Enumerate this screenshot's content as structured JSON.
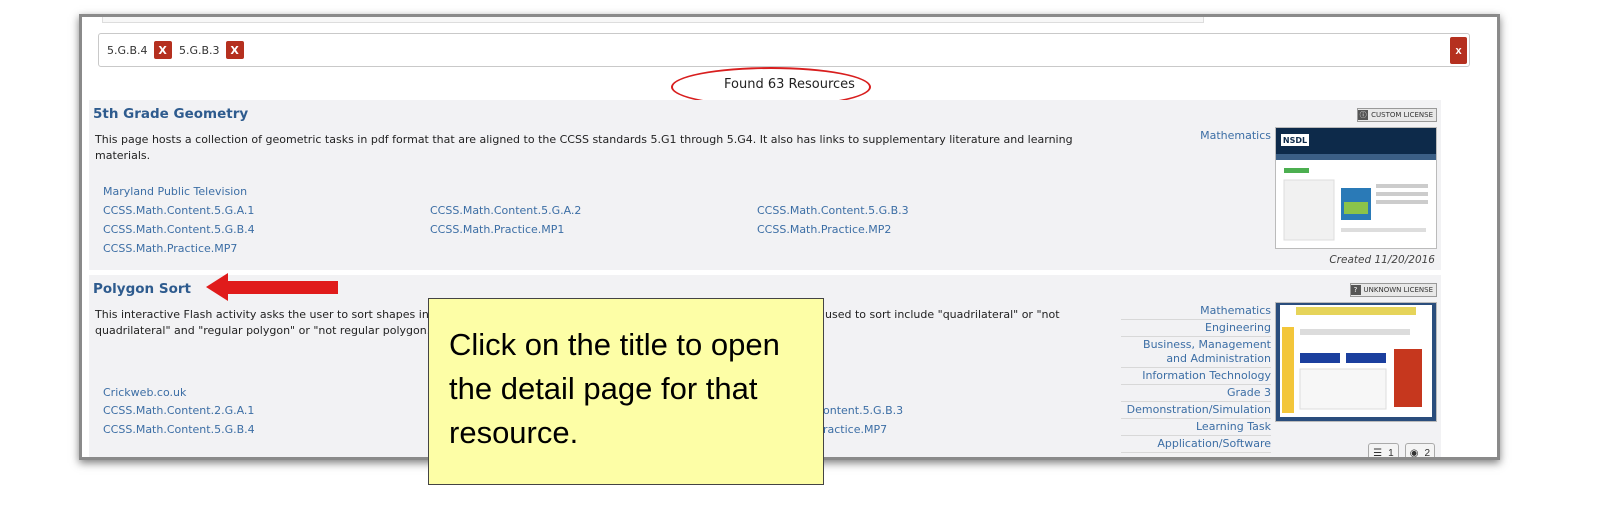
{
  "filters": {
    "chips": [
      {
        "label": "5.G.B.4",
        "remove": "X"
      },
      {
        "label": "5.G.B.3",
        "remove": "X"
      }
    ],
    "clear_all": "x"
  },
  "found_text": "Found 63 Resources",
  "results": [
    {
      "title": "5th Grade Geometry",
      "description": "This page hosts a collection of geometric tasks in pdf format that are aligned to the CCSS standards 5.G1 through 5.G4. It also has links to supplementary literature and learning materials.",
      "publisher": "Maryland Public Television",
      "standards": [
        "CCSS.Math.Content.5.G.A.1",
        "CCSS.Math.Content.5.G.A.2",
        "CCSS.Math.Content.5.G.B.3",
        "CCSS.Math.Content.5.G.B.4",
        "CCSS.Math.Practice.MP1",
        "CCSS.Math.Practice.MP2",
        "CCSS.Math.Practice.MP7"
      ],
      "subjects": [
        "Mathematics"
      ],
      "license": "CUSTOM LICENSE",
      "created": "Created 11/20/2016",
      "thumb_logo": "NSDL"
    },
    {
      "title": "Polygon Sort",
      "description_left": "This interactive Flash activity asks the user to sort shapes into a 2",
      "description_right": "used to sort include \"quadrilateral\" or \"not",
      "description_line2": "quadrilateral\" and \"regular polygon\" or \"not regular polygon.\"",
      "publisher": "Crickweb.co.uk",
      "standards": [
        "CCSS.Math.Content.2.G.A.1",
        "CCSS.Math.Content.5.G.B.4",
        "ontent.5.G.B.3",
        "ractice.MP7"
      ],
      "subjects": [
        "Mathematics",
        "Engineering",
        "Business, Management and Administration",
        "Information Technology",
        "Grade 3",
        "Demonstration/Simulation",
        "Learning Task",
        "Application/Software"
      ],
      "license": "UNKNOWN LICENSE",
      "counters": [
        "1",
        "2"
      ]
    }
  ],
  "social": {
    "icons": [
      "pinterest-icon",
      "flipboard-icon",
      "linkedin-icon",
      "email-icon",
      "print-icon",
      "plus-icon"
    ],
    "glyphs": {
      "linkedin": "in",
      "plus": "+",
      "pinterest": "p"
    }
  },
  "callout_text": "Click on the title to open the detail page for that resource.",
  "colors": {
    "accent_blue": "#1f5fa8",
    "remove_red": "#b5301f",
    "callout_bg": "#fdfea6",
    "annotation_red": "#e01b1b"
  }
}
